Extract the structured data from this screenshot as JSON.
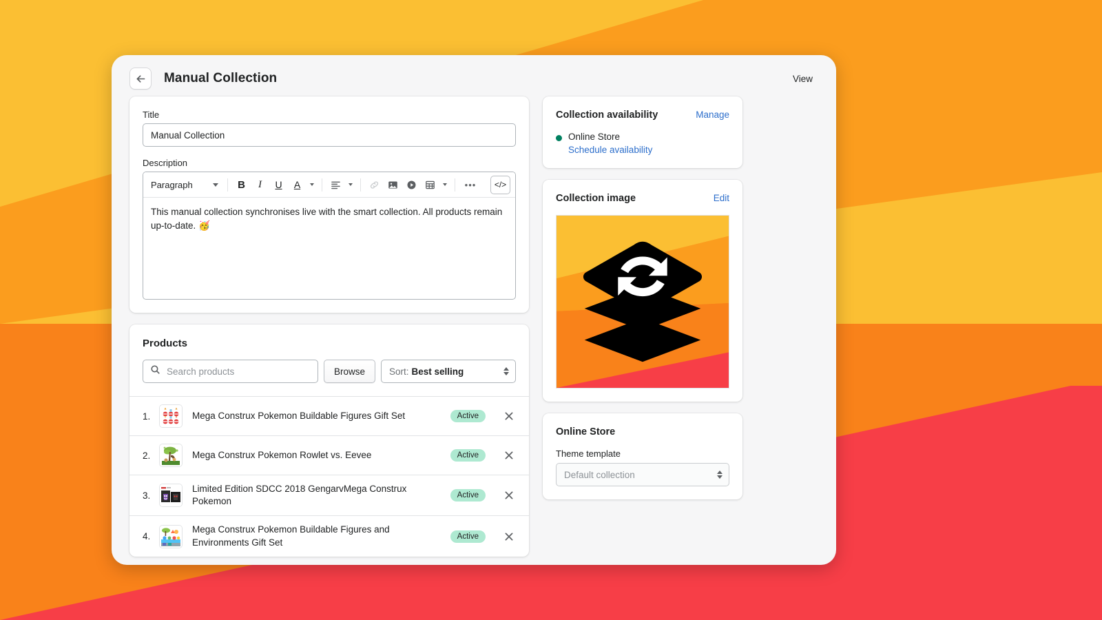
{
  "background": {
    "colors": [
      "#FBBF33",
      "#FB9D1E",
      "#F9821A",
      "#F73E47"
    ]
  },
  "header": {
    "back_icon": "arrow-left-icon",
    "title": "Manual Collection",
    "view_label": "View"
  },
  "title_field": {
    "label": "Title",
    "value": "Manual Collection"
  },
  "description_field": {
    "label": "Description",
    "toolbar": {
      "style_value": "Paragraph",
      "bold": "B",
      "italic": "I",
      "underline": "U",
      "text_color": "A",
      "align": "align-left-icon",
      "link": "link-icon",
      "image": "image-icon",
      "video": "video-icon",
      "table": "table-icon",
      "more": "•••",
      "code": "</>"
    },
    "body": "This manual collection synchronises live with the smart collection. All products remain up-to-date. 🥳"
  },
  "products": {
    "title": "Products",
    "search_placeholder": "Search products",
    "search_value": "",
    "search_icon": "search-icon",
    "browse_label": "Browse",
    "sort_label": "Sort:",
    "sort_value": "Best selling",
    "badge_color": "#AEE9D1",
    "items": [
      {
        "index": "1.",
        "name": "Mega Construx Pokemon Buildable Figures Gift Set",
        "status": "Active",
        "thumb": "pokeballs-grid"
      },
      {
        "index": "2.",
        "name": "Mega Construx Pokemon Rowlet vs. Eevee",
        "status": "Active",
        "thumb": "tree-scene"
      },
      {
        "index": "3.",
        "name": "Limited Edition SDCC 2018 GengarvMega Construx Pokemon",
        "status": "Active",
        "thumb": "gengar-boxes"
      },
      {
        "index": "4.",
        "name": "Mega Construx Pokemon Buildable Figures and Environments Gift Set",
        "status": "Active",
        "thumb": "environment-set"
      }
    ]
  },
  "availability": {
    "title": "Collection availability",
    "manage_label": "Manage",
    "channel": "Online Store",
    "status_color": "#008060",
    "schedule_label": "Schedule availability"
  },
  "collection_image": {
    "title": "Collection image",
    "edit_label": "Edit",
    "image_alt": "layers-sync-icon"
  },
  "online_store": {
    "title": "Online Store",
    "theme_label": "Theme template",
    "theme_value": "Default collection"
  }
}
